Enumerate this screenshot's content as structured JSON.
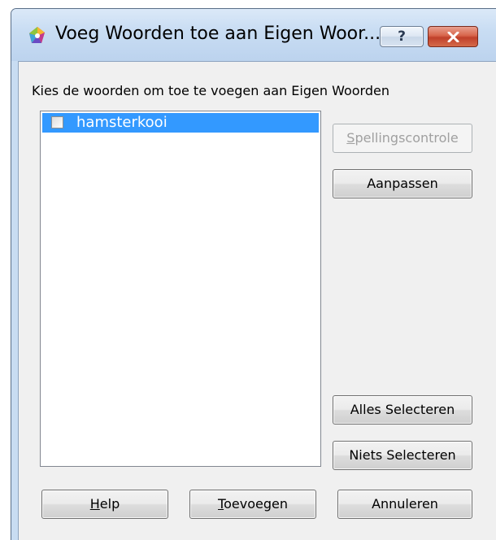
{
  "window": {
    "title": "Voeg Woorden toe aan Eigen Woor...",
    "help_button": "?",
    "close_button": "close"
  },
  "instruction": "Kies de woorden om toe te voegen aan Eigen Woorden",
  "words": [
    {
      "label": "hamsterkooi",
      "checked": false,
      "selected": true
    }
  ],
  "side_buttons": {
    "spellcheck": {
      "mnemonic": "S",
      "rest": "pellingscontrole",
      "enabled": false
    },
    "customize": {
      "label": "Aanpassen",
      "enabled": true
    },
    "select_all": {
      "label": "Alles Selecteren"
    },
    "select_none": {
      "label": "Niets Selecteren"
    }
  },
  "bottom_buttons": {
    "help": {
      "mnemonic": "H",
      "rest": "elp"
    },
    "add": {
      "mnemonic": "T",
      "rest": "oevoegen"
    },
    "cancel": {
      "label": "Annuleren"
    }
  },
  "colors": {
    "selection": "#3399ff",
    "frame": "#c8dcf2",
    "close_button": "#c0402a"
  }
}
